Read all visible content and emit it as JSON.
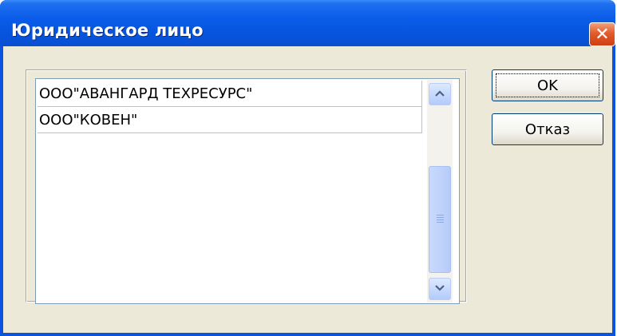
{
  "window": {
    "title": "Юридическое лицо",
    "close_glyph": "✕"
  },
  "list": {
    "items": [
      "ООО\"АВАНГАРД ТЕХРЕСУРС\"",
      "ООО\"КОВЕН\""
    ]
  },
  "scrollbar": {
    "up_icon": "chevron-up-icon",
    "down_icon": "chevron-down-icon",
    "up_glyph": "︿",
    "down_glyph": "﹀"
  },
  "buttons": {
    "ok_label": "OK",
    "cancel_label": "Отказ"
  },
  "colors": {
    "titlebar": "#0654dc",
    "client_bg": "#ece9d8",
    "close_button": "#e35b2b"
  }
}
